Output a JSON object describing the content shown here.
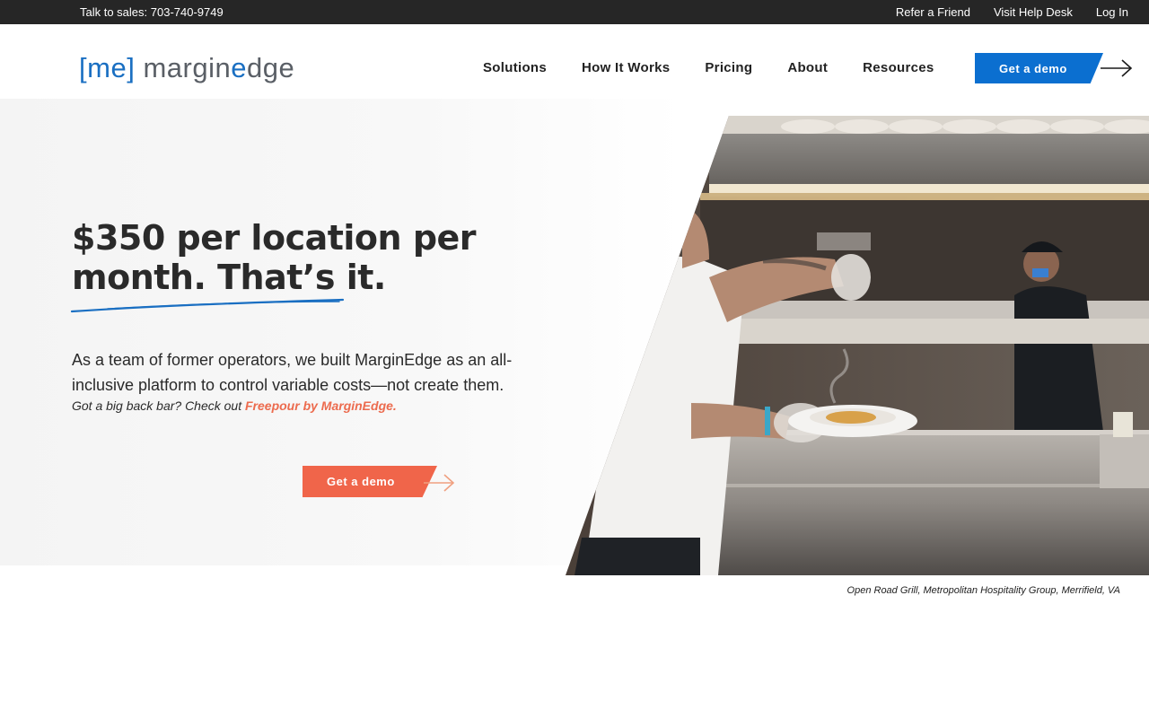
{
  "topbar": {
    "sales": "Talk to sales: 703-740-9749",
    "links": [
      "Refer a Friend",
      "Visit Help Desk",
      "Log In"
    ]
  },
  "logo": {
    "bracket_open": "[",
    "me": "me",
    "bracket_close": "]",
    "word_a": "margin",
    "word_accent": "e",
    "word_b": "dge"
  },
  "nav": {
    "items": [
      "Solutions",
      "How It Works",
      "Pricing",
      "About",
      "Resources"
    ],
    "cta": "Get a demo"
  },
  "hero": {
    "headline_line1": "$350 per location per",
    "headline_line2": "month. That’s it.",
    "body": "As a team of former operators, we built MarginEdge as an all-inclusive platform to control variable costs—not create them.",
    "backbar_prefix": "Got a big back bar? Check out ",
    "backbar_link": "Freepour by MarginEdge.",
    "cta": "Get a demo",
    "caption": "Open Road Grill, Metropolitan Hospitality Group, Merrifield, VA"
  },
  "colors": {
    "brand_blue": "#0b6fd0",
    "accent_orange": "#f0654a",
    "topbar": "#262626"
  },
  "icons": {
    "nav_cta_arrow": "arrow-right-icon",
    "hero_cta_arrow": "arrow-right-icon"
  }
}
